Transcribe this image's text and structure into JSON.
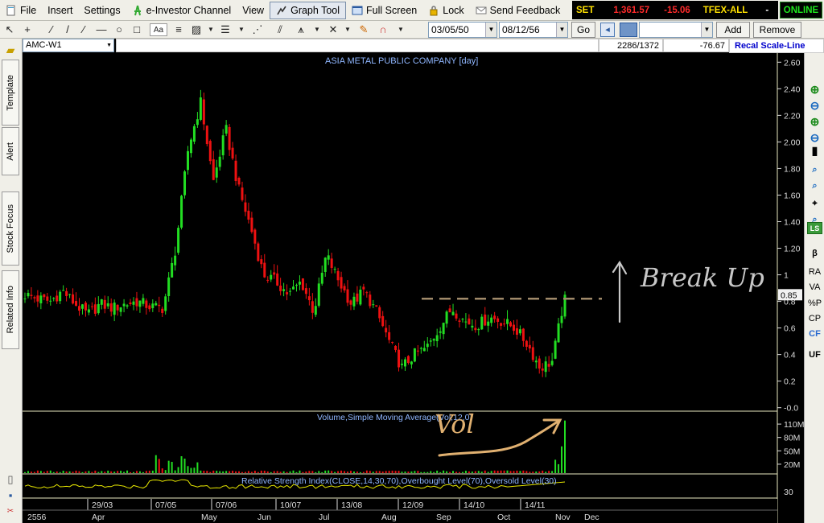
{
  "menu": {
    "items": [
      "File",
      "Insert",
      "Settings",
      "e-Investor Channel",
      "View",
      "Graph Tool",
      "Full Screen",
      "Lock",
      "Send Feedback"
    ],
    "active_item": "Graph Tool"
  },
  "ticker": {
    "market": "SET",
    "index_value": "1,361.57",
    "change": "-15.06",
    "futures": "TFEX-ALL",
    "futures_value": "-",
    "status": "ONLINE"
  },
  "toolbar": {
    "start_date": "03/05/50",
    "end_date": "08/12/56",
    "go_label": "Go",
    "add_label": "Add",
    "remove_label": "Remove",
    "font_label": "Aa"
  },
  "symbol_row": {
    "symbol": "AMC-W1",
    "position_readout": "2286/1372",
    "value_readout": "-76.67",
    "recal_label": "Recal Scale-Line"
  },
  "left_tabs": [
    "Template",
    "Alert",
    "Stock Focus",
    "Related Info"
  ],
  "right_tools": [
    "+",
    "-",
    "+",
    "-",
    "zoom-in",
    "zoom-out",
    "LS",
    "β",
    "RA",
    "VA",
    "%P",
    "CP",
    "CF",
    "UF"
  ],
  "colors": {
    "up": "#22dd22",
    "down": "#ee1111",
    "axis": "#dddddd",
    "title": "#8fb6ff",
    "rsi_line": "#e6e600",
    "annotation": "#c8c8c8",
    "dashed_level": "#a08a6a"
  },
  "chart_data": [
    {
      "type": "candlestick",
      "title": "ASIA METAL PUBLIC COMPANY [day]",
      "y_ticks": [
        "2.60",
        "2.40",
        "2.20",
        "2.00",
        "1.80",
        "1.60",
        "1.40",
        "1.20",
        "1",
        "0.8",
        "0.6",
        "0.4",
        "0.2",
        "-0.0"
      ],
      "ylim": [
        -0.02,
        2.62
      ],
      "last_price_label": "0.85",
      "x_labels_top": [
        "29/03",
        "07/05",
        "07/06",
        "10/07",
        "13/08",
        "12/09",
        "14/10",
        "14/11"
      ],
      "x_labels_bottom": [
        "2556",
        "Apr",
        "May",
        "Jun",
        "Jul",
        "Aug",
        "Sep",
        "Oct",
        "Nov",
        "Dec"
      ],
      "close_path": [
        0.85,
        0.82,
        0.8,
        0.88,
        0.78,
        0.7,
        0.78,
        0.75,
        0.78,
        0.8,
        0.76,
        0.75,
        1.2,
        1.95,
        2.3,
        1.7,
        2.1,
        1.65,
        1.35,
        1.0,
        0.95,
        0.85,
        0.95,
        0.72,
        1.15,
        0.95,
        0.78,
        0.88,
        0.72,
        0.5,
        0.3,
        0.4,
        0.45,
        0.6,
        0.75,
        0.65,
        0.62,
        0.68,
        0.65,
        0.6,
        0.48,
        0.3,
        0.35,
        0.85
      ],
      "annotations": [
        "Break Up",
        "Vol"
      ]
    },
    {
      "type": "bar",
      "title": "Volume,Simple Moving Average(Vol,12,0)",
      "y_ticks": [
        "110M",
        "80M",
        "50M",
        "20M"
      ],
      "ylim": [
        0,
        130
      ]
    },
    {
      "type": "line",
      "title": "Relative Strength Index(CLOSE,14,30,70),Overbought Level(70),Oversold Level(30)",
      "y_ticks": [
        "30"
      ],
      "ylim": [
        0,
        100
      ]
    }
  ]
}
